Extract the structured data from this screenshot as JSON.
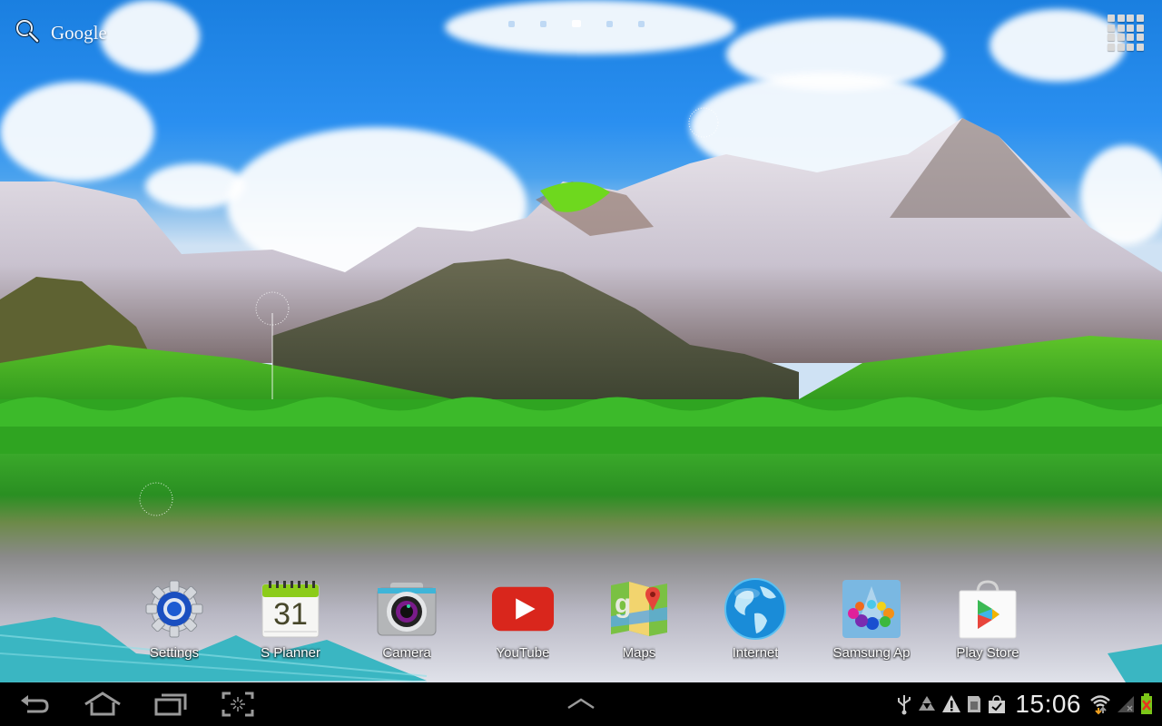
{
  "search_bar": {
    "label": "Google",
    "icon": "search-icon"
  },
  "home_pages": {
    "count": 5,
    "active_index": 2
  },
  "apps_button": {
    "icon": "apps-grid-icon"
  },
  "dock": {
    "apps": [
      {
        "label": "Settings",
        "icon": "settings-gear-icon"
      },
      {
        "label": "S Planner",
        "icon": "calendar-icon",
        "badge": "31"
      },
      {
        "label": "Camera",
        "icon": "camera-icon"
      },
      {
        "label": "YouTube",
        "icon": "youtube-icon"
      },
      {
        "label": "Maps",
        "icon": "maps-icon"
      },
      {
        "label": "Internet",
        "icon": "globe-icon"
      },
      {
        "label": "Samsung Ap",
        "icon": "samsung-apps-icon"
      },
      {
        "label": "Play Store",
        "icon": "play-store-icon"
      }
    ]
  },
  "navigation": {
    "back": "back-icon",
    "home": "home-icon",
    "recents": "recent-apps-icon",
    "screenshot": "screen-capture-icon",
    "expand": "chevron-up-icon"
  },
  "status_bar": {
    "time": "15:06",
    "icons": [
      "usb-icon",
      "recycle-icon",
      "warning-icon",
      "sd-card-icon",
      "shopping-bag-check-icon",
      "wifi-icon",
      "signal-icon",
      "battery-icon"
    ]
  },
  "colors": {
    "navbar_bg": "#000000",
    "youtube_red": "#d9261c",
    "calendar_green": "#8ccc1a",
    "battery_green": "#7bc618",
    "battery_x": "#e8321e"
  }
}
